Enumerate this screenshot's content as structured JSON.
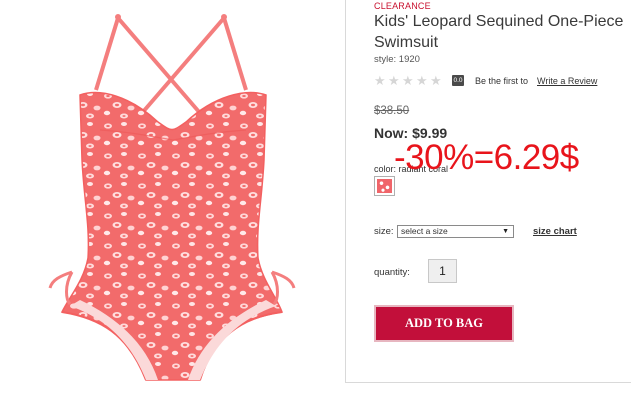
{
  "product": {
    "tag": "CLEARANCE",
    "title": "Kids' Leopard Sequined One-Piece Swimsuit",
    "style": "style: 1920",
    "rating_badge": "0.0",
    "first_text": "Be the first to",
    "write_review": "Write a Review",
    "old_price": "$38.50",
    "now_price": "Now: $9.99",
    "color_label": "color: radiant coral",
    "size_label": "size:",
    "size_select_value": "select a size",
    "size_chart": "size chart",
    "quantity_label": "quantity:",
    "quantity_value": "1",
    "add_to_bag": "ADD TO BAG",
    "star_rating": 0,
    "star_count": 5
  },
  "overlay": {
    "discount_text": "-30%=6.29$"
  },
  "colors": {
    "accent": "#c20f3a",
    "clearance": "#c8102e",
    "overlay_red": "#e8141b",
    "swimsuit_base": "#f26b6b"
  },
  "icons": {
    "star": "star-icon",
    "dropdown": "chevron-down-icon"
  }
}
